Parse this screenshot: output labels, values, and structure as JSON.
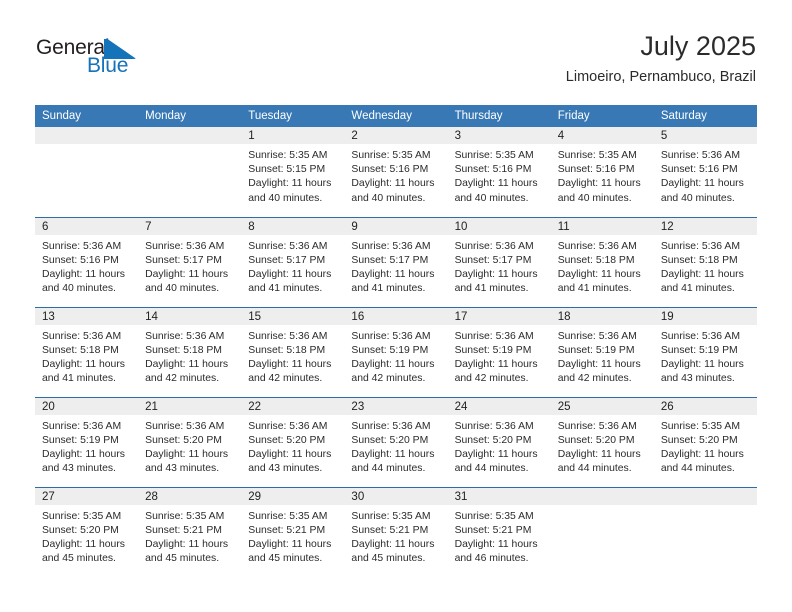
{
  "brand": {
    "name_part1": "General",
    "name_part2": "Blue",
    "flag_icon": "triangle-flag-icon",
    "accent_color": "#1573b9"
  },
  "header": {
    "title": "July 2025",
    "subtitle": "Limoeiro, Pernambuco, Brazil"
  },
  "theme": {
    "header_row_bg": "#3878b4",
    "grid_line": "#2f6da8",
    "date_strip_bg": "#eeeeee"
  },
  "calendar": {
    "weekday_headers": [
      "Sunday",
      "Monday",
      "Tuesday",
      "Wednesday",
      "Thursday",
      "Friday",
      "Saturday"
    ],
    "weeks": [
      [
        {
          "day": "",
          "lines": []
        },
        {
          "day": "",
          "lines": []
        },
        {
          "day": "1",
          "lines": [
            "Sunrise: 5:35 AM",
            "Sunset: 5:15 PM",
            "Daylight: 11 hours",
            "and 40 minutes."
          ]
        },
        {
          "day": "2",
          "lines": [
            "Sunrise: 5:35 AM",
            "Sunset: 5:16 PM",
            "Daylight: 11 hours",
            "and 40 minutes."
          ]
        },
        {
          "day": "3",
          "lines": [
            "Sunrise: 5:35 AM",
            "Sunset: 5:16 PM",
            "Daylight: 11 hours",
            "and 40 minutes."
          ]
        },
        {
          "day": "4",
          "lines": [
            "Sunrise: 5:35 AM",
            "Sunset: 5:16 PM",
            "Daylight: 11 hours",
            "and 40 minutes."
          ]
        },
        {
          "day": "5",
          "lines": [
            "Sunrise: 5:36 AM",
            "Sunset: 5:16 PM",
            "Daylight: 11 hours",
            "and 40 minutes."
          ]
        }
      ],
      [
        {
          "day": "6",
          "lines": [
            "Sunrise: 5:36 AM",
            "Sunset: 5:16 PM",
            "Daylight: 11 hours",
            "and 40 minutes."
          ]
        },
        {
          "day": "7",
          "lines": [
            "Sunrise: 5:36 AM",
            "Sunset: 5:17 PM",
            "Daylight: 11 hours",
            "and 40 minutes."
          ]
        },
        {
          "day": "8",
          "lines": [
            "Sunrise: 5:36 AM",
            "Sunset: 5:17 PM",
            "Daylight: 11 hours",
            "and 41 minutes."
          ]
        },
        {
          "day": "9",
          "lines": [
            "Sunrise: 5:36 AM",
            "Sunset: 5:17 PM",
            "Daylight: 11 hours",
            "and 41 minutes."
          ]
        },
        {
          "day": "10",
          "lines": [
            "Sunrise: 5:36 AM",
            "Sunset: 5:17 PM",
            "Daylight: 11 hours",
            "and 41 minutes."
          ]
        },
        {
          "day": "11",
          "lines": [
            "Sunrise: 5:36 AM",
            "Sunset: 5:18 PM",
            "Daylight: 11 hours",
            "and 41 minutes."
          ]
        },
        {
          "day": "12",
          "lines": [
            "Sunrise: 5:36 AM",
            "Sunset: 5:18 PM",
            "Daylight: 11 hours",
            "and 41 minutes."
          ]
        }
      ],
      [
        {
          "day": "13",
          "lines": [
            "Sunrise: 5:36 AM",
            "Sunset: 5:18 PM",
            "Daylight: 11 hours",
            "and 41 minutes."
          ]
        },
        {
          "day": "14",
          "lines": [
            "Sunrise: 5:36 AM",
            "Sunset: 5:18 PM",
            "Daylight: 11 hours",
            "and 42 minutes."
          ]
        },
        {
          "day": "15",
          "lines": [
            "Sunrise: 5:36 AM",
            "Sunset: 5:18 PM",
            "Daylight: 11 hours",
            "and 42 minutes."
          ]
        },
        {
          "day": "16",
          "lines": [
            "Sunrise: 5:36 AM",
            "Sunset: 5:19 PM",
            "Daylight: 11 hours",
            "and 42 minutes."
          ]
        },
        {
          "day": "17",
          "lines": [
            "Sunrise: 5:36 AM",
            "Sunset: 5:19 PM",
            "Daylight: 11 hours",
            "and 42 minutes."
          ]
        },
        {
          "day": "18",
          "lines": [
            "Sunrise: 5:36 AM",
            "Sunset: 5:19 PM",
            "Daylight: 11 hours",
            "and 42 minutes."
          ]
        },
        {
          "day": "19",
          "lines": [
            "Sunrise: 5:36 AM",
            "Sunset: 5:19 PM",
            "Daylight: 11 hours",
            "and 43 minutes."
          ]
        }
      ],
      [
        {
          "day": "20",
          "lines": [
            "Sunrise: 5:36 AM",
            "Sunset: 5:19 PM",
            "Daylight: 11 hours",
            "and 43 minutes."
          ]
        },
        {
          "day": "21",
          "lines": [
            "Sunrise: 5:36 AM",
            "Sunset: 5:20 PM",
            "Daylight: 11 hours",
            "and 43 minutes."
          ]
        },
        {
          "day": "22",
          "lines": [
            "Sunrise: 5:36 AM",
            "Sunset: 5:20 PM",
            "Daylight: 11 hours",
            "and 43 minutes."
          ]
        },
        {
          "day": "23",
          "lines": [
            "Sunrise: 5:36 AM",
            "Sunset: 5:20 PM",
            "Daylight: 11 hours",
            "and 44 minutes."
          ]
        },
        {
          "day": "24",
          "lines": [
            "Sunrise: 5:36 AM",
            "Sunset: 5:20 PM",
            "Daylight: 11 hours",
            "and 44 minutes."
          ]
        },
        {
          "day": "25",
          "lines": [
            "Sunrise: 5:36 AM",
            "Sunset: 5:20 PM",
            "Daylight: 11 hours",
            "and 44 minutes."
          ]
        },
        {
          "day": "26",
          "lines": [
            "Sunrise: 5:35 AM",
            "Sunset: 5:20 PM",
            "Daylight: 11 hours",
            "and 44 minutes."
          ]
        }
      ],
      [
        {
          "day": "27",
          "lines": [
            "Sunrise: 5:35 AM",
            "Sunset: 5:20 PM",
            "Daylight: 11 hours",
            "and 45 minutes."
          ]
        },
        {
          "day": "28",
          "lines": [
            "Sunrise: 5:35 AM",
            "Sunset: 5:21 PM",
            "Daylight: 11 hours",
            "and 45 minutes."
          ]
        },
        {
          "day": "29",
          "lines": [
            "Sunrise: 5:35 AM",
            "Sunset: 5:21 PM",
            "Daylight: 11 hours",
            "and 45 minutes."
          ]
        },
        {
          "day": "30",
          "lines": [
            "Sunrise: 5:35 AM",
            "Sunset: 5:21 PM",
            "Daylight: 11 hours",
            "and 45 minutes."
          ]
        },
        {
          "day": "31",
          "lines": [
            "Sunrise: 5:35 AM",
            "Sunset: 5:21 PM",
            "Daylight: 11 hours",
            "and 46 minutes."
          ]
        },
        {
          "day": "",
          "lines": []
        },
        {
          "day": "",
          "lines": []
        }
      ]
    ]
  }
}
